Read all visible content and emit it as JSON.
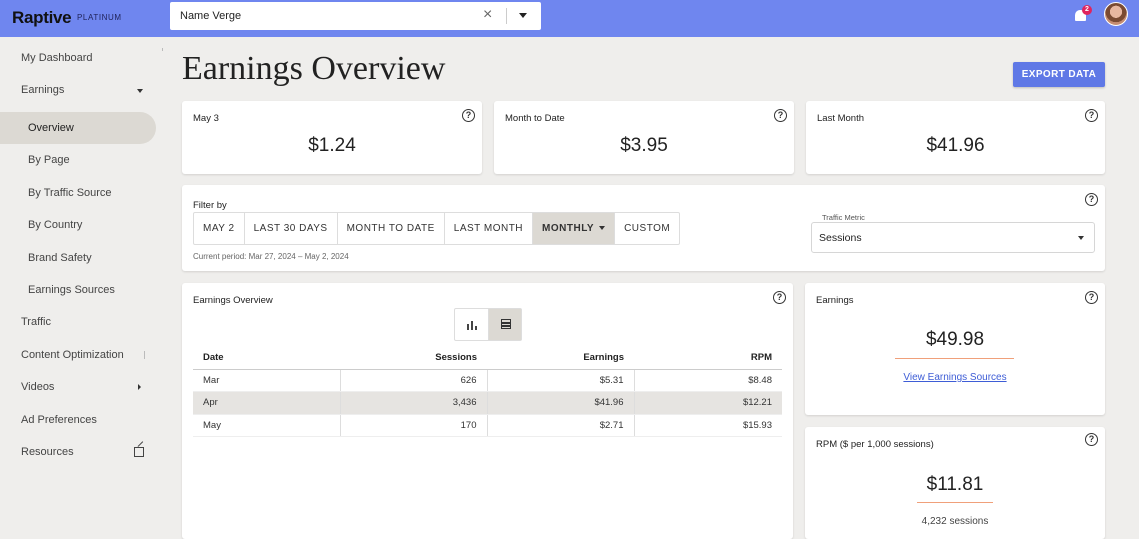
{
  "brand": {
    "name": "Raptive",
    "tier": "PLATINUM"
  },
  "site_selector": {
    "value": "Name Verge",
    "clear_glyph": "×"
  },
  "notifications": {
    "count": "2"
  },
  "sidebar": {
    "items": [
      {
        "label": "My Dashboard"
      },
      {
        "label": "Earnings"
      },
      {
        "label": "Overview"
      },
      {
        "label": "By Page"
      },
      {
        "label": "By Traffic Source"
      },
      {
        "label": "By Country"
      },
      {
        "label": "Brand Safety"
      },
      {
        "label": "Earnings Sources"
      },
      {
        "label": "Traffic"
      },
      {
        "label": "Content Optimization"
      },
      {
        "label": "Videos"
      },
      {
        "label": "Ad Preferences"
      },
      {
        "label": "Resources"
      }
    ]
  },
  "page": {
    "title": "Earnings Overview",
    "export_label": "EXPORT DATA"
  },
  "summary": {
    "day": {
      "label": "May 3",
      "value": "$1.24"
    },
    "mtd": {
      "label": "Month to Date",
      "value": "$3.95"
    },
    "last_month": {
      "label": "Last Month",
      "value": "$41.96"
    }
  },
  "filter": {
    "label": "Filter by",
    "options": [
      "MAY 2",
      "LAST 30 DAYS",
      "MONTH TO DATE",
      "LAST MONTH",
      "MONTHLY",
      "CUSTOM"
    ],
    "selected": "MONTHLY",
    "period": "Current period: Mar 27, 2024 – May 2, 2024",
    "metric_label": "Traffic Metric",
    "metric_value": "Sessions"
  },
  "overview_table": {
    "title": "Earnings Overview",
    "headers": [
      "Date",
      "Sessions",
      "Earnings",
      "RPM"
    ],
    "rows": [
      [
        "Mar",
        "626",
        "$5.31",
        "$8.48"
      ],
      [
        "Apr",
        "3,436",
        "$41.96",
        "$12.21"
      ],
      [
        "May",
        "170",
        "$2.71",
        "$15.93"
      ]
    ]
  },
  "earnings_card": {
    "label": "Earnings",
    "value": "$49.98",
    "link": "View Earnings Sources"
  },
  "rpm_card": {
    "label": "RPM ($ per 1,000 sessions)",
    "value": "$11.81",
    "sessions": "4,232 sessions"
  },
  "colors": {
    "topbar": "#6f86ef",
    "accent": "#5f78e6",
    "link": "#3e5dd6",
    "rule": "#f0a07a"
  }
}
